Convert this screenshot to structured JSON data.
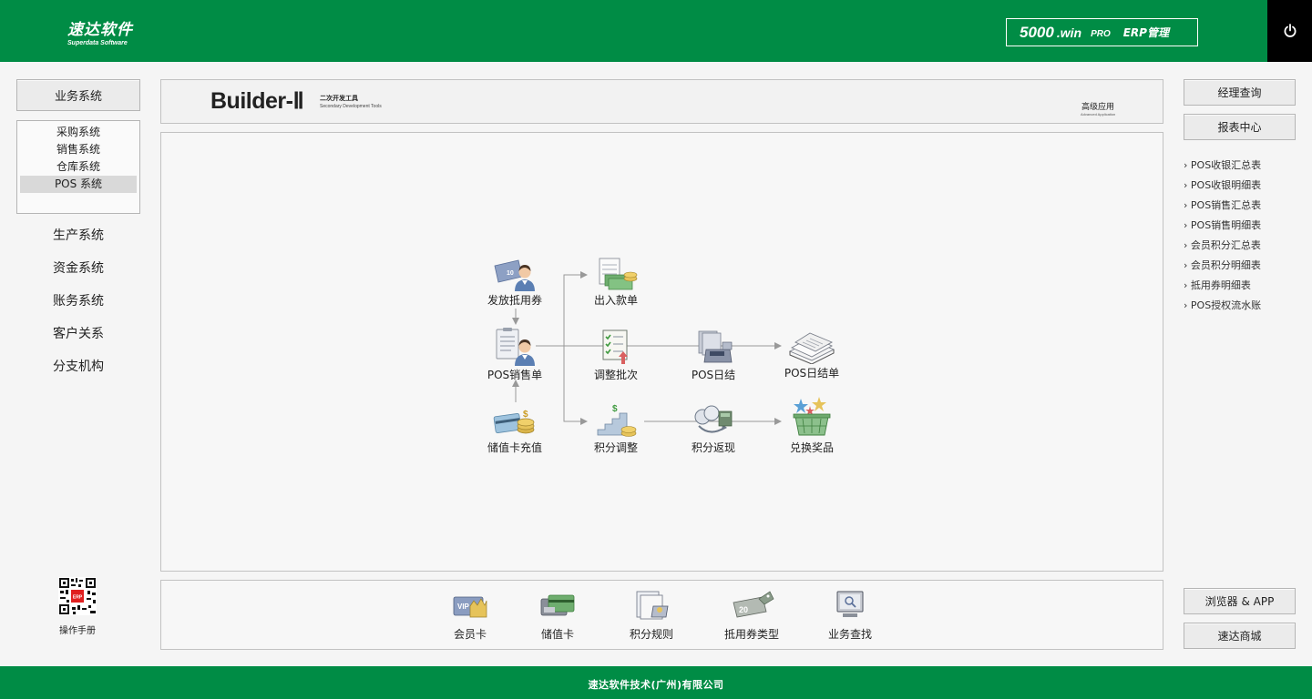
{
  "header": {
    "logo_cn": "速达软件",
    "logo_en": "Superdata Software",
    "product_main": "5000",
    "product_win": ".win",
    "product_pro": "PRO",
    "product_erp": "ERP管理",
    "power_icon": "power-icon",
    "bg_color": "#008c45"
  },
  "left_nav": {
    "business_button": "业务系统",
    "subsystems": [
      "采购系统",
      "销售系统",
      "仓库系统",
      "POS 系统"
    ],
    "selected_subsystem": "POS 系统",
    "items": [
      "生产系统",
      "资金系统",
      "账务系统",
      "客户关系",
      "分支机构"
    ],
    "manual_label": "操作手册"
  },
  "banner": {
    "title": "Builder-Ⅱ",
    "subtitle_cn": "二次开发工具",
    "subtitle_en": "Secondary Development Tools",
    "right_cn": "高级应用",
    "right_en": "Advanced Application"
  },
  "flow": {
    "nodes": {
      "issue_voucher": "发放抵用券",
      "pos_sales": "POS销售单",
      "stored_card_recharge": "储值卡充值",
      "cash_in_out": "出入款单",
      "adjust_batch": "调整批次",
      "points_adjust": "积分调整",
      "pos_daily": "POS日结",
      "points_cashback": "积分返现",
      "pos_daily_statement": "POS日结单",
      "redeem_prize": "兑换奖品"
    }
  },
  "bottom_tools": [
    "会员卡",
    "储值卡",
    "积分规则",
    "抵用券类型",
    "业务查找"
  ],
  "right_panel": {
    "manager_query": "经理查询",
    "report_center": "报表中心",
    "reports": [
      "POS收银汇总表",
      "POS收银明细表",
      "POS销售汇总表",
      "POS销售明细表",
      "会员积分汇总表",
      "会员积分明细表",
      "抵用券明细表",
      "POS授权流水账"
    ],
    "browser_app": "浏览器 & APP",
    "mall": "速达商城"
  },
  "footer": {
    "company": "速达软件技术(广州)有限公司"
  }
}
